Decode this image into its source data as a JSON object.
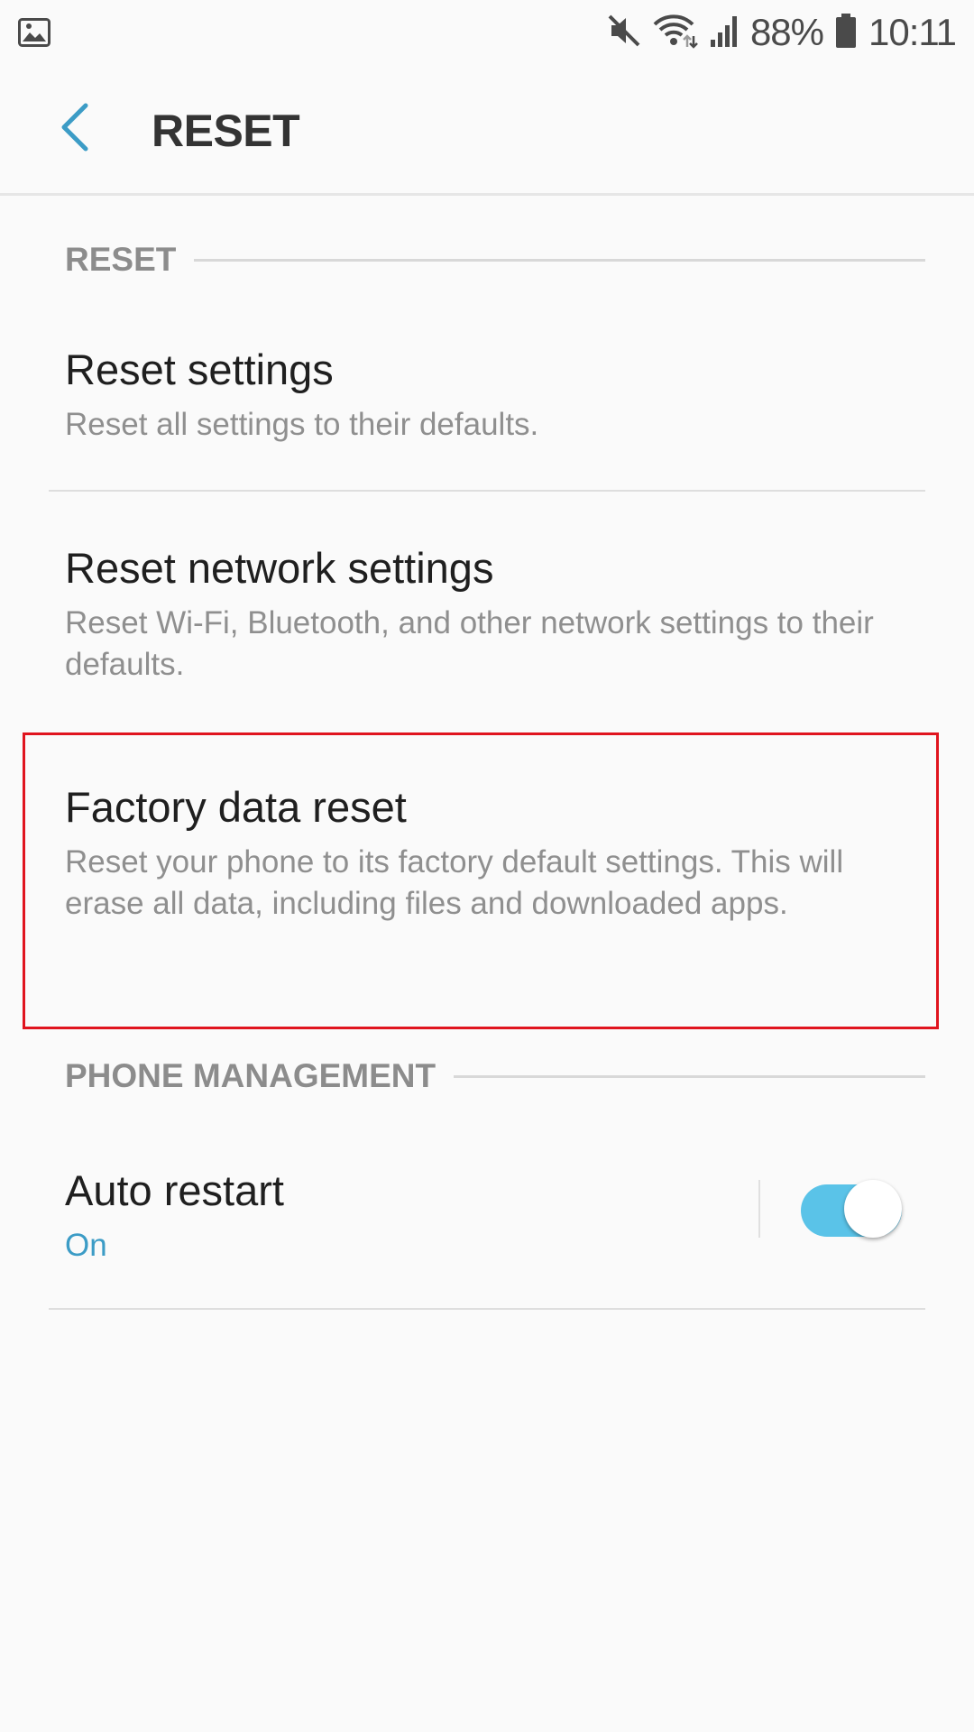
{
  "status_bar": {
    "left_icon": "gallery-notification-icon",
    "icons": [
      "mute-icon",
      "wifi-icon",
      "signal-icon",
      "battery-icon"
    ],
    "battery_percent": "88%",
    "time": "10:11"
  },
  "header": {
    "back_icon": "chevron-left-icon",
    "title": "RESET"
  },
  "sections": {
    "reset": {
      "header": "RESET",
      "items": [
        {
          "title": "Reset settings",
          "summary": "Reset all settings to their defaults."
        },
        {
          "title": "Reset network settings",
          "summary": "Reset Wi-Fi, Bluetooth, and other network settings to their defaults."
        },
        {
          "title": "Factory data reset",
          "summary": "Reset your phone to its factory default settings. This will erase all data, including files and downloaded apps."
        }
      ]
    },
    "phone_management": {
      "header": "PHONE MANAGEMENT",
      "items": [
        {
          "title": "Auto restart",
          "summary": "On",
          "toggle_on": true
        }
      ]
    }
  },
  "colors": {
    "accent": "#3c9cc6",
    "toggle_track_on": "#5ac3e8",
    "highlight_box": "#e0141e",
    "background": "#fafafa"
  }
}
